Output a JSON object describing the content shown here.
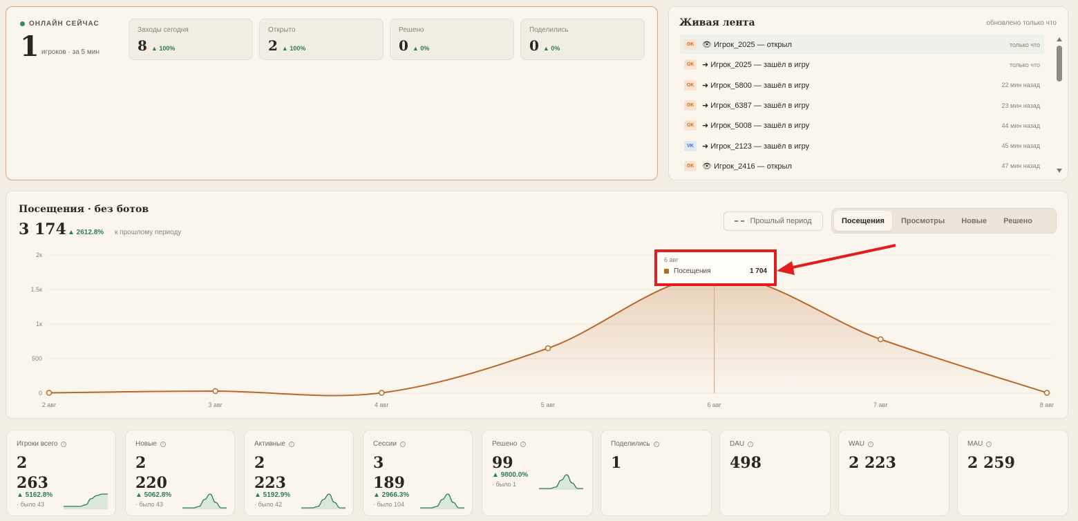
{
  "online": {
    "label": "ОНЛАЙН СЕЙЧАС",
    "value": "1",
    "sub": "игроков · за 5 мин",
    "tiles": [
      {
        "label": "Заходы сегодня",
        "value": "8",
        "pct": "▲ 100%"
      },
      {
        "label": "Открыто",
        "value": "2",
        "pct": "▲ 100%"
      },
      {
        "label": "Решено",
        "value": "0",
        "pct": "▲ 0%"
      },
      {
        "label": "Поделились",
        "value": "0",
        "pct": "▲ 0%"
      }
    ]
  },
  "feed": {
    "title": "Живая лента",
    "updated": "обновлено только что",
    "items": [
      {
        "badge": "OK",
        "text": "👁 Игрок_2025 — открыл",
        "time": "только что"
      },
      {
        "badge": "OK",
        "text": "➜ Игрок_2025 — зашёл в игру",
        "time": "только что"
      },
      {
        "badge": "OK",
        "text": "➜ Игрок_5800 — зашёл в игру",
        "time": "22 мин назад"
      },
      {
        "badge": "OK",
        "text": "➜ Игрок_6387 — зашёл в игру",
        "time": "23 мин назад"
      },
      {
        "badge": "OK",
        "text": "➜ Игрок_5008 — зашёл в игру",
        "time": "44 мин назад"
      },
      {
        "badge": "VK",
        "text": "➜ Игрок_2123 — зашёл в игру",
        "time": "45 мин назад"
      },
      {
        "badge": "OK",
        "text": "👁 Игрок_2416 — открыл",
        "time": "47 мин назад"
      }
    ]
  },
  "visits": {
    "title": "Посещения · без ботов",
    "total": "3 174",
    "pct": "▲ 2612.8%",
    "compare": "к прошлому периоду",
    "prev_period": "Прошлый период",
    "tabs": [
      "Посещения",
      "Просмотры",
      "Новые",
      "Решено"
    ]
  },
  "tooltip": {
    "date": "6 авг",
    "series": "Посещения",
    "value": "1 704"
  },
  "chart_data": {
    "type": "area",
    "categories": [
      "2 авг",
      "3 авг",
      "4 авг",
      "5 авг",
      "6 авг",
      "7 авг",
      "8 авг"
    ],
    "series": [
      {
        "name": "Посещения",
        "values": [
          5,
          30,
          5,
          650,
          1704,
          780,
          5
        ]
      }
    ],
    "yticks": [
      "0",
      "500",
      "1к",
      "1.5к",
      "2к"
    ],
    "ylim": [
      0,
      2000
    ],
    "color": "#b8682b"
  },
  "stats": [
    {
      "label": "Игроки всего",
      "v1": "2",
      "v2": "263",
      "pct": "▲ 5162.8%",
      "was": "· было 43",
      "spark": [
        1,
        1,
        1,
        1,
        2,
        6,
        8,
        9,
        9
      ]
    },
    {
      "label": "Новые",
      "v1": "2",
      "v2": "220",
      "pct": "▲ 5062.8%",
      "was": "· было 43",
      "spark": [
        0,
        0,
        0,
        1,
        6,
        10,
        4,
        0,
        0
      ]
    },
    {
      "label": "Активные",
      "v1": "2",
      "v2": "223",
      "pct": "▲ 5192.9%",
      "was": "· было 42",
      "spark": [
        0,
        0,
        0,
        1,
        6,
        10,
        4,
        0,
        0
      ]
    },
    {
      "label": "Сессии",
      "v1": "3",
      "v2": "189",
      "pct": "▲ 2966.3%",
      "was": "· было 104",
      "spark": [
        0,
        0,
        0,
        1,
        6,
        10,
        4,
        0,
        0
      ]
    },
    {
      "label": "Решено",
      "v1": "99",
      "v2": "",
      "pct": "▲ 9800.0%",
      "was": "· было 1",
      "spark": [
        0,
        0,
        0,
        1,
        6,
        10,
        4,
        0,
        0
      ]
    },
    {
      "label": "Поделились",
      "v1": "1",
      "v2": "",
      "pct": "",
      "was": "",
      "spark": []
    },
    {
      "label": "DAU",
      "v1": "498",
      "v2": "",
      "pct": "",
      "was": "",
      "spark": []
    },
    {
      "label": "WAU",
      "v1": "2 223",
      "v2": "",
      "pct": "",
      "was": "",
      "spark": []
    },
    {
      "label": "MAU",
      "v1": "2 259",
      "v2": "",
      "pct": "",
      "was": "",
      "spark": []
    }
  ]
}
